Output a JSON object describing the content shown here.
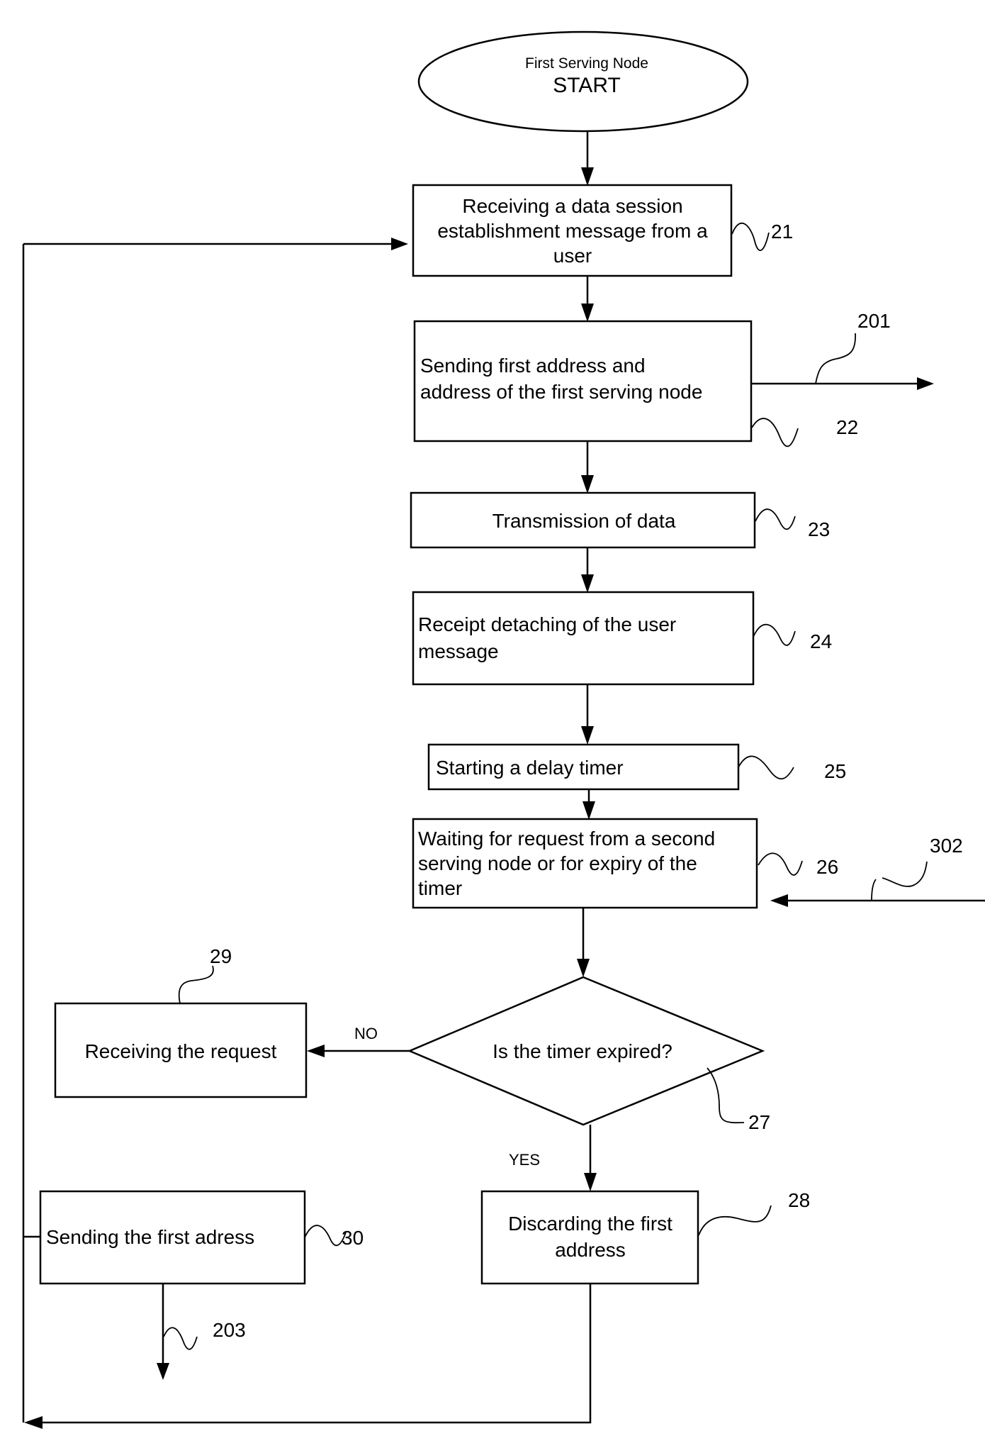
{
  "diagram": {
    "type": "flowchart",
    "start": {
      "line1": "First Serving Node",
      "line2": "START"
    },
    "steps": [
      {
        "id": "21",
        "ref": "21",
        "lines": [
          "Receiving a data session",
          "establishment message from a",
          "user"
        ]
      },
      {
        "id": "22",
        "ref": "22",
        "lines": [
          "Sending first address and",
          "address of the first serving node"
        ]
      },
      {
        "id": "23",
        "ref": "23",
        "lines": [
          "Transmission of data"
        ]
      },
      {
        "id": "24",
        "ref": "24",
        "lines": [
          "Receipt  detaching of the user",
          "message"
        ]
      },
      {
        "id": "25",
        "ref": "25",
        "lines": [
          "Starting a delay timer"
        ]
      },
      {
        "id": "26",
        "ref": "26",
        "lines": [
          "Waiting for request from a second",
          "serving node or for expiry of the",
          "timer"
        ]
      },
      {
        "id": "27",
        "ref": "27",
        "lines": [
          "Is the timer expired?"
        ],
        "kind": "decision"
      },
      {
        "id": "28",
        "ref": "28",
        "lines": [
          "Discarding the first",
          "address"
        ]
      },
      {
        "id": "29",
        "ref": "29",
        "lines": [
          "Receiving the request"
        ]
      },
      {
        "id": "30",
        "ref": "30",
        "lines": [
          "Sending the first adress"
        ]
      }
    ],
    "branch_labels": {
      "no": "NO",
      "yes": "YES"
    },
    "signal_refs": {
      "out_201": "201",
      "in_302": "302",
      "out_203": "203"
    }
  }
}
